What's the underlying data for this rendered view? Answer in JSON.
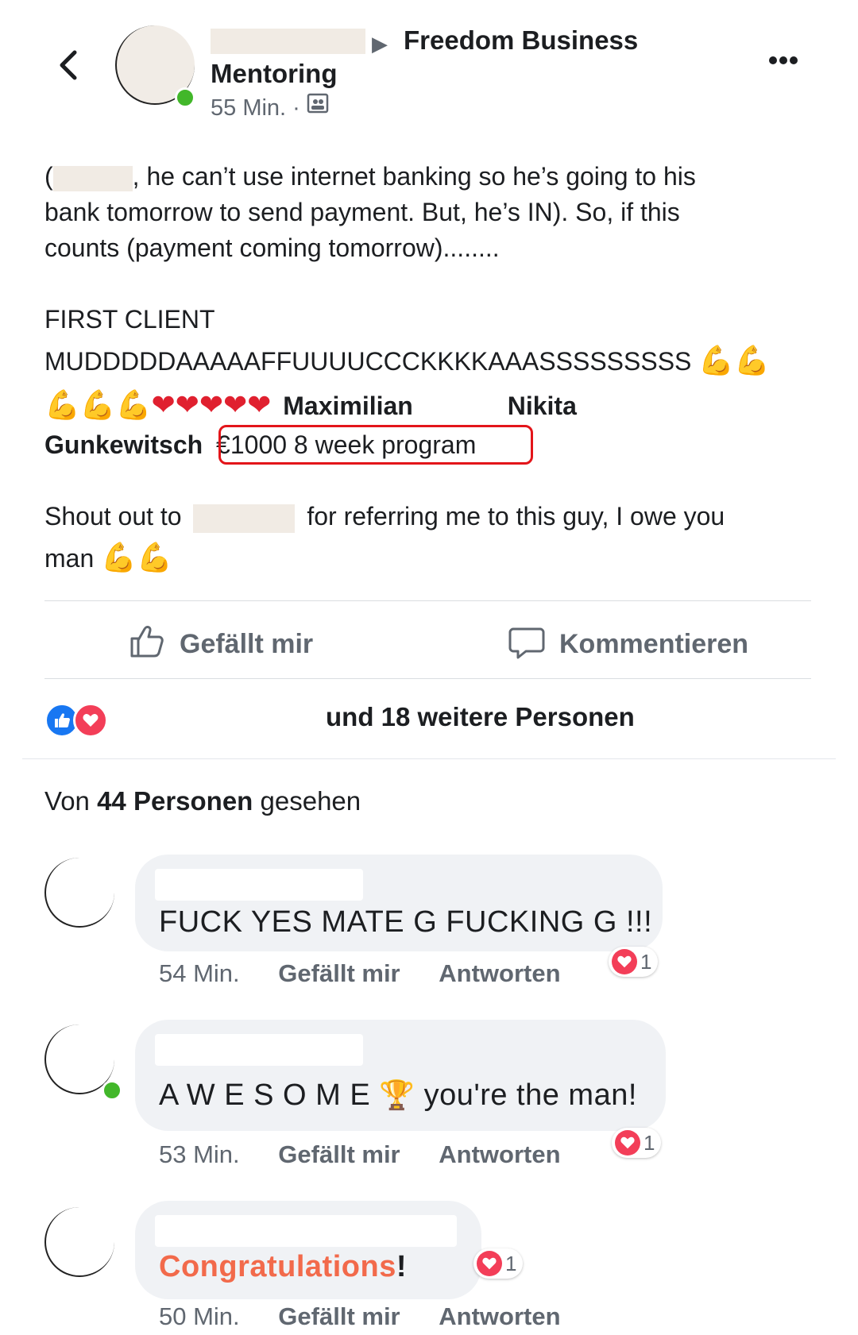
{
  "post": {
    "group_name_part1": "Freedom Business",
    "group_name_part2": "Mentoring",
    "time": "55 Min.",
    "separator": "·",
    "para1_open": "(",
    "para1_rest_line1": ", he can’t use internet banking so he’s going to his",
    "para1_line2": "bank tomorrow to send payment. But, he’s IN). So, if this",
    "para1_line3": "counts (payment coming tomorrow)........",
    "first_client": "FIRST CLIENT",
    "shout_line": "MUDDDDDAAAAAFFUUUUCCCKKKKAAASSSSSSSSS",
    "tag1": "Maximilian",
    "tag2": "Nikita",
    "tag3": "Gunkewitsch",
    "price": "€1000 8 week program",
    "shoutout_a": "Shout out to",
    "shoutout_b": "for referring me to this guy, I owe you",
    "shoutout_c": "man",
    "muscle": "💪",
    "heart": "❤"
  },
  "actions": {
    "like": "Gefällt mir",
    "comment": "Kommentieren"
  },
  "reactions": {
    "others": "und 18 weitere Personen"
  },
  "seen": {
    "prefix": "Von",
    "count": "44 Personen",
    "suffix": "gesehen"
  },
  "comments": [
    {
      "text": "FUCK YES MATE G FUCKING G !!!",
      "time": "54 Min.",
      "like": "Gefällt mir",
      "reply": "Antworten",
      "reactions": "1"
    },
    {
      "text_a": "A W E S O M E",
      "trophy": "🏆",
      "text_b": "you're the man!",
      "time": "53 Min.",
      "like": "Gefällt mir",
      "reply": "Antworten",
      "reactions": "1"
    },
    {
      "text": "Congratulations",
      "excl": "!",
      "time": "50 Min.",
      "like": "Gefällt mir",
      "reply": "Antworten",
      "reactions": "1"
    }
  ],
  "colors": {
    "accent_like": "#1877f2",
    "accent_love": "#f33e58",
    "highlight_box": "#e3151a",
    "congrats": "#f26a4b"
  },
  "icons": [
    "back-chevron-icon",
    "more-dots-icon",
    "audience-icon",
    "thumbs-up-icon",
    "comment-bubble-icon",
    "like-reaction-icon",
    "love-reaction-icon"
  ]
}
